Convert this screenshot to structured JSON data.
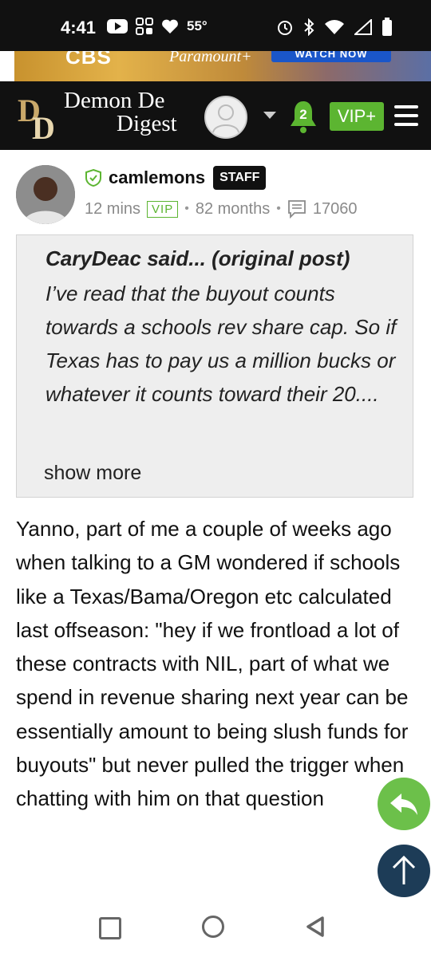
{
  "status_bar": {
    "time": "4:41",
    "temperature": "55°"
  },
  "ad": {
    "brand": "CBS",
    "partner": "Paramount+",
    "cta": "WATCH NOW"
  },
  "header": {
    "site_name_line1": "Demon De",
    "site_name_line2": "Digest",
    "notification_count": "2",
    "vip_label": "VIP+",
    "colors": {
      "accent_green": "#5cb531",
      "header_bg": "#111111"
    }
  },
  "post": {
    "username": "camlemons",
    "badge": "STAFF",
    "time_ago": "12 mins",
    "vip_tag": "VIP",
    "membership": "82 months",
    "post_count": "17060",
    "quote": {
      "attribution": "CaryDeac said... (original post)",
      "text": "I’ve read that the buyout counts towards a schools rev share cap. So if Texas has to pay us a million bucks or whatever it counts toward their 20....",
      "show_more": "show more"
    },
    "body": "Yanno, part of me a couple of weeks ago when talking to a GM wondered if schools like a Texas/Bama/Oregon etc calculated last offseason: \"hey if we frontload a lot of these contracts with NIL, part of what we spend in revenue sharing next year can be essentially amount to being slush funds for buyouts\" but never pulled the trigger when chatting with him on that question"
  },
  "icons": {
    "reply": "reply-icon",
    "scroll_top": "arrow-up-icon"
  }
}
